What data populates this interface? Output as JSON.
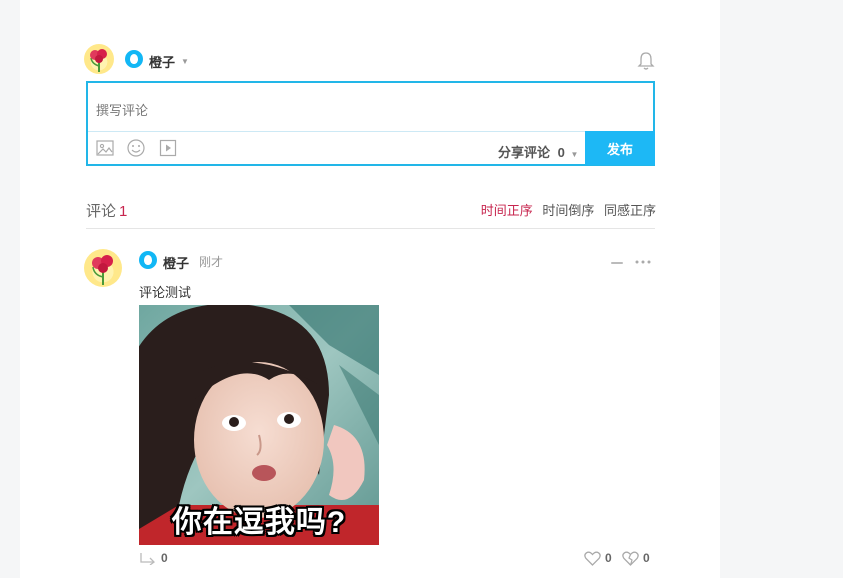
{
  "composer": {
    "user_name": "橙子",
    "placeholder": "撰写评论",
    "share_label": "分享评论",
    "share_count": "0",
    "publish_label": "发布"
  },
  "comments_header": {
    "title": "评论",
    "count": "1",
    "sort_options": [
      "时间正序",
      "时间倒序",
      "同感正序"
    ],
    "active_sort": "时间正序"
  },
  "comment": {
    "user_name": "橙子",
    "time": "刚才",
    "text": "评论测试",
    "image_caption": "你在逗我吗?",
    "share_count": "0",
    "like_count": "0",
    "dislike_count": "0"
  },
  "colors": {
    "accent": "#1db8f5",
    "active_sort": "#c7254e",
    "qq_blue": "#12b7f5"
  }
}
